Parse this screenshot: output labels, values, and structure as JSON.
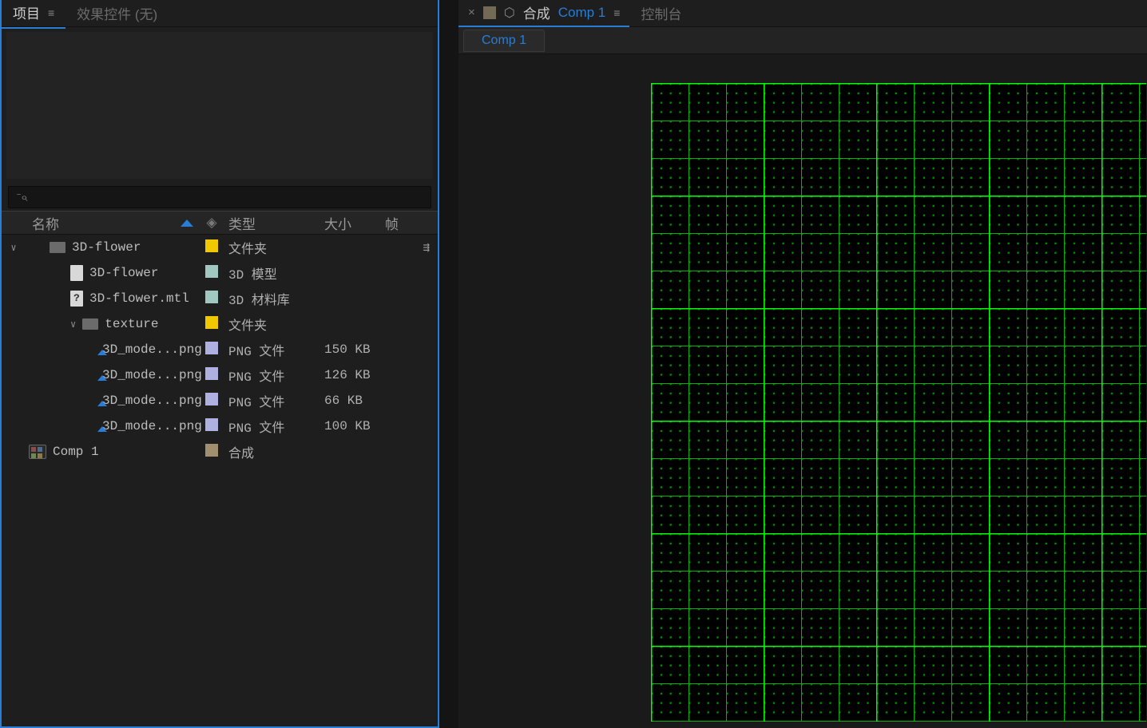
{
  "left_panel": {
    "tabs": {
      "project": "项目",
      "effects": "效果控件 (无)"
    },
    "columns": {
      "name": "名称",
      "type": "类型",
      "size": "大小",
      "fps": "帧"
    },
    "items": [
      {
        "indent": 1,
        "toggle": "∨",
        "icon": "folder",
        "name": "3D-flower",
        "swatch": "#f0c800",
        "type": "文件夹",
        "size": "",
        "extra": "flowchart"
      },
      {
        "indent": 2,
        "toggle": "",
        "icon": "file",
        "name": "3D-flower",
        "swatch": "#a0c8c0",
        "type": "3D 模型",
        "size": ""
      },
      {
        "indent": 2,
        "toggle": "",
        "icon": "file-q",
        "name": "3D-flower.mtl",
        "swatch": "#a0c8c0",
        "type": "3D 材料库",
        "size": ""
      },
      {
        "indent": 2,
        "toggle": "∨",
        "icon": "folder",
        "name": "texture",
        "swatch": "#f0c800",
        "type": "文件夹",
        "size": ""
      },
      {
        "indent": 3,
        "toggle": "",
        "icon": "png",
        "name": "3D_mode...png",
        "swatch": "#b0b0e0",
        "type": "PNG 文件",
        "size": "150 KB"
      },
      {
        "indent": 3,
        "toggle": "",
        "icon": "png",
        "name": "3D_mode...png",
        "swatch": "#b0b0e0",
        "type": "PNG 文件",
        "size": "126 KB"
      },
      {
        "indent": 3,
        "toggle": "",
        "icon": "png",
        "name": "3D_mode...png",
        "swatch": "#b0b0e0",
        "type": "PNG 文件",
        "size": "66 KB"
      },
      {
        "indent": 3,
        "toggle": "",
        "icon": "png",
        "name": "3D_mode...png",
        "swatch": "#b0b0e0",
        "type": "PNG 文件",
        "size": "100 KB"
      },
      {
        "indent": 0,
        "toggle": "",
        "icon": "comp",
        "name": "Comp 1",
        "swatch": "#a09070",
        "type": "合成",
        "size": ""
      }
    ]
  },
  "right_panel": {
    "tab_label": "合成",
    "active_comp": "Comp 1",
    "console_tab": "控制台",
    "mini_tab": "Comp 1"
  }
}
